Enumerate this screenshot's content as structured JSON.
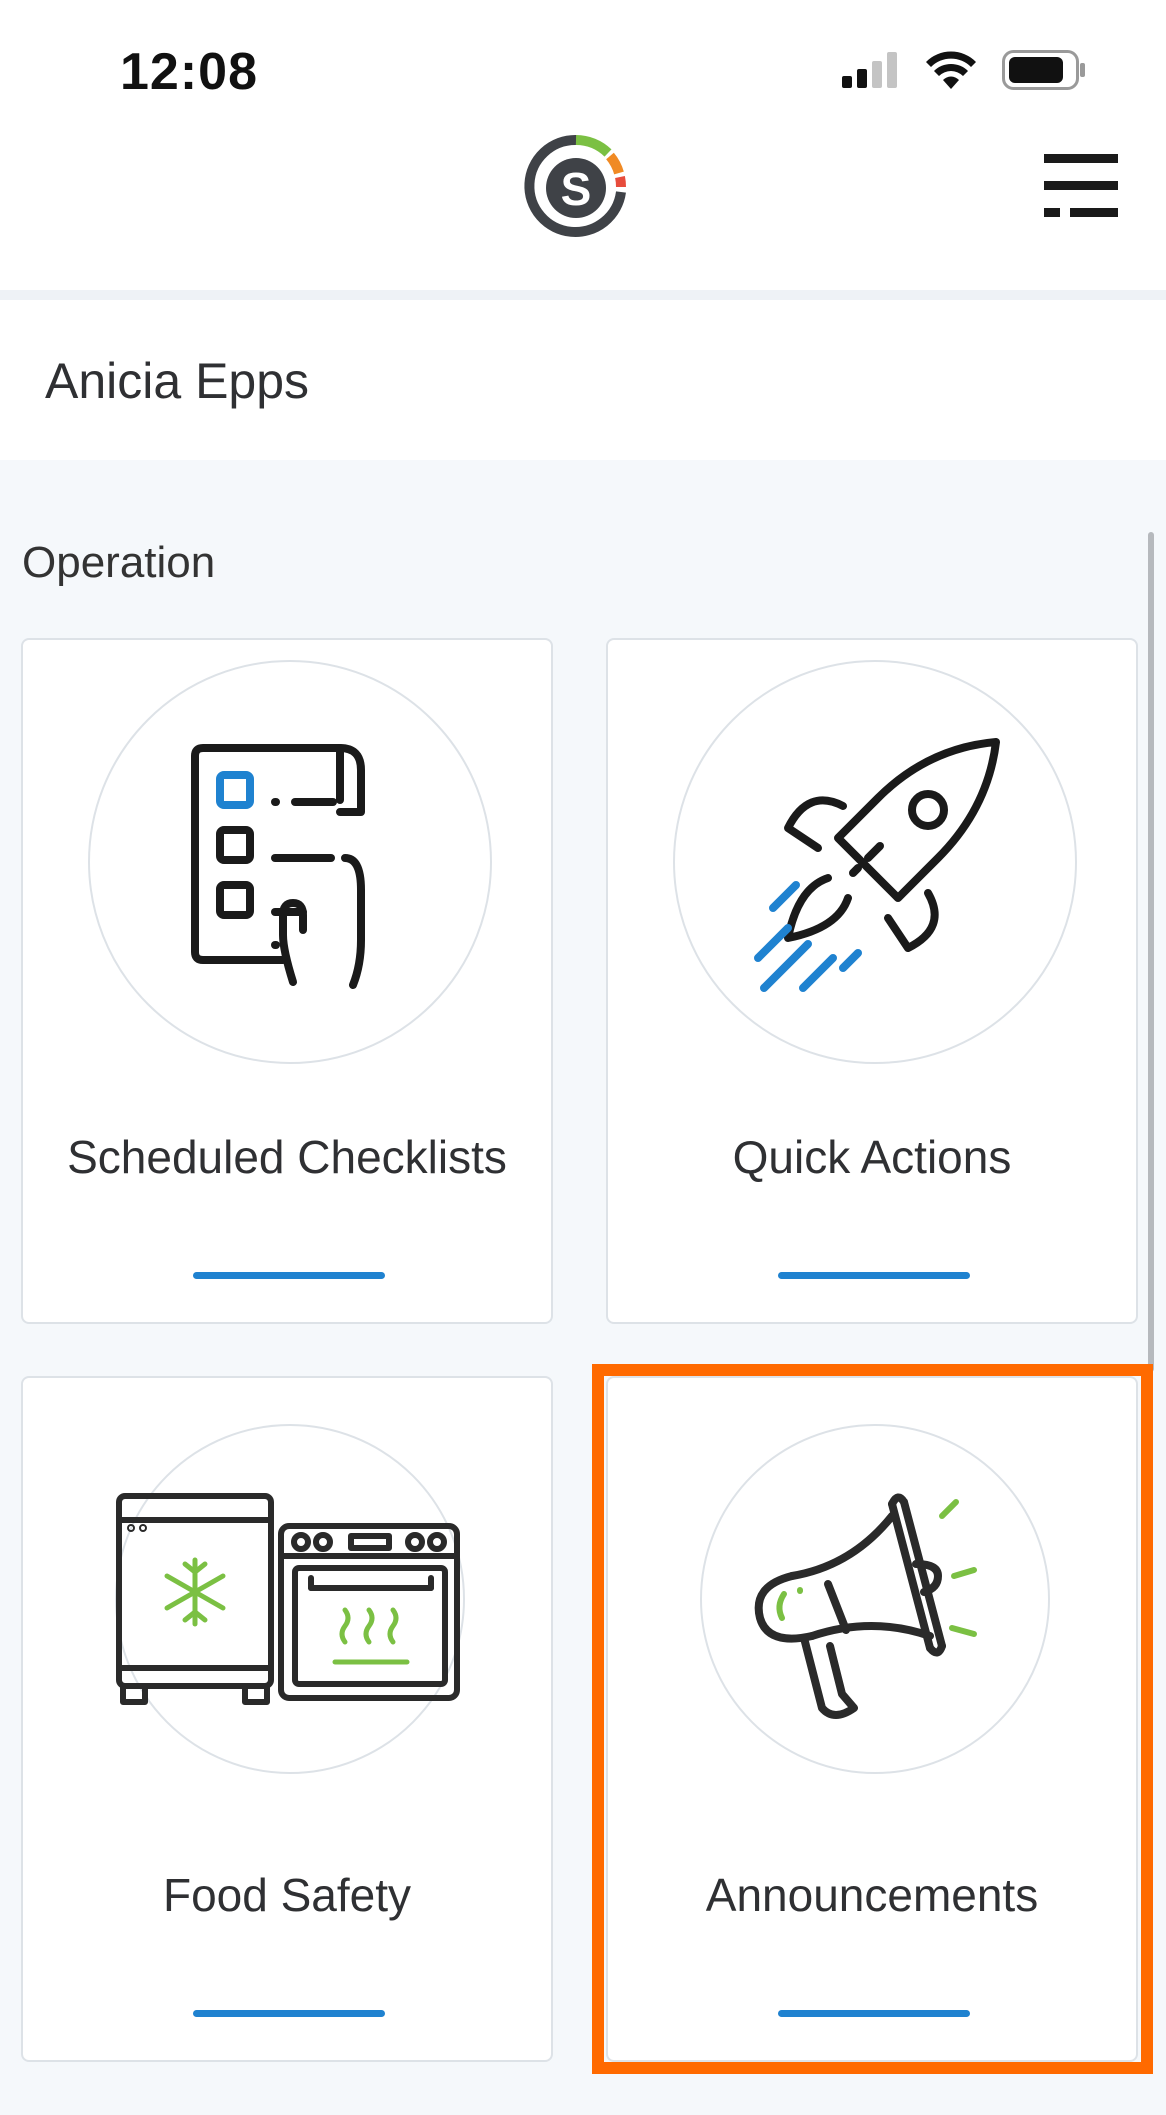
{
  "status_bar": {
    "time": "12:08",
    "icons": [
      "cellular-signal-icon",
      "wifi-icon",
      "battery-icon"
    ]
  },
  "header": {
    "logo_letter": "S",
    "logo_icon": "app-logo-icon",
    "menu_icon": "hamburger-menu-icon"
  },
  "location": {
    "name": "Anicia Epps"
  },
  "section": {
    "title": "Operation",
    "tiles": [
      {
        "label": "Scheduled Checklists",
        "icon": "checklist-icon"
      },
      {
        "label": "Quick Actions",
        "icon": "rocket-icon"
      },
      {
        "label": "Food Safety",
        "icon": "freezer-oven-icon"
      },
      {
        "label": "Announcements",
        "icon": "megaphone-icon"
      }
    ]
  },
  "colors": {
    "accent_blue": "#1f82d0",
    "accent_green": "#7bc043",
    "highlight_orange": "#ff6a00",
    "logo_orange": "#f08a24",
    "logo_red": "#e74c3c",
    "icon_dark": "#1a1a1a"
  }
}
